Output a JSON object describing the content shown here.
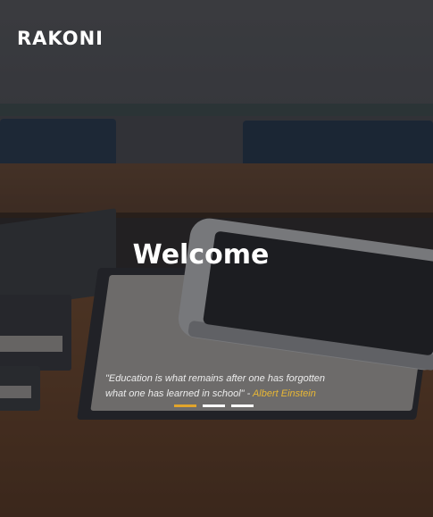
{
  "header": {
    "logo": "RAKONI"
  },
  "hero": {
    "title": "Welcome",
    "quote_text": "\"Education is what remains after one has forgotten what one has learned in school\" - ",
    "quote_author": "Albert Einstein"
  },
  "carousel": {
    "slide_count": 3,
    "active_index": 0
  },
  "colors": {
    "accent": "#e1a52c",
    "author": "#e8b735",
    "text": "#ffffff"
  }
}
